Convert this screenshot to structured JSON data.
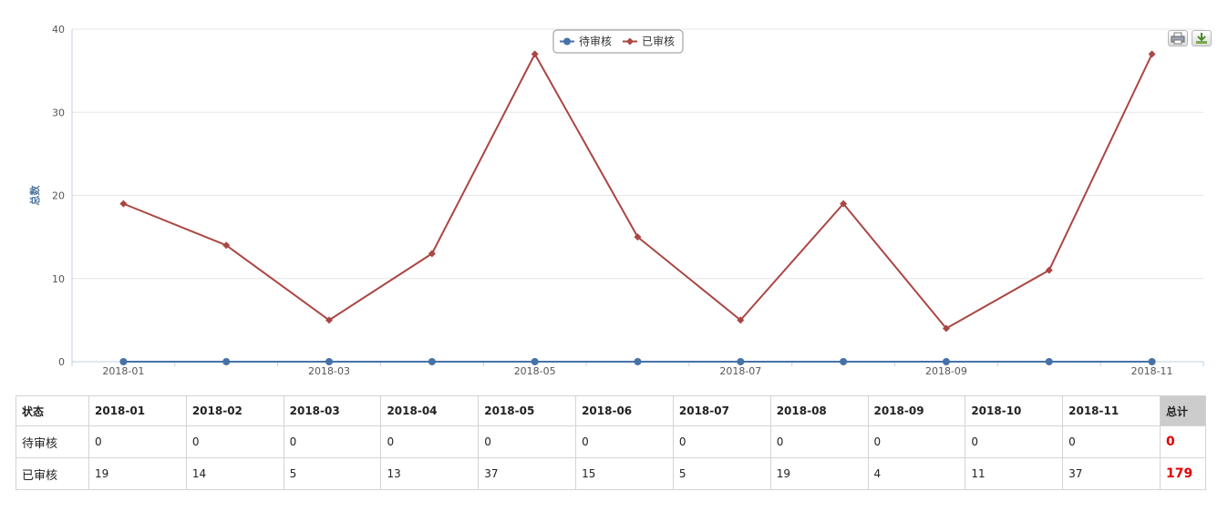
{
  "chart_data": {
    "type": "line",
    "categories": [
      "2018-01",
      "2018-02",
      "2018-03",
      "2018-04",
      "2018-05",
      "2018-06",
      "2018-07",
      "2018-08",
      "2018-09",
      "2018-10",
      "2018-11"
    ],
    "x_tick_labels": [
      "2018-01",
      "2018-03",
      "2018-05",
      "2018-07",
      "2018-09",
      "2018-11"
    ],
    "y_ticks": [
      0,
      10,
      20,
      30,
      40
    ],
    "ylim": [
      0,
      40
    ],
    "ylabel": "总数",
    "title": "",
    "grid": true,
    "legend_position": "top-center",
    "series": [
      {
        "name": "待审核",
        "color": "#4572A7",
        "marker": "circle",
        "values": [
          0,
          0,
          0,
          0,
          0,
          0,
          0,
          0,
          0,
          0,
          0
        ]
      },
      {
        "name": "已审核",
        "color": "#AA4643",
        "marker": "diamond",
        "values": [
          19,
          14,
          5,
          13,
          37,
          15,
          5,
          19,
          4,
          11,
          37
        ]
      }
    ]
  },
  "table": {
    "header_label": "状态",
    "total_label": "总计",
    "columns": [
      "2018-01",
      "2018-02",
      "2018-03",
      "2018-04",
      "2018-05",
      "2018-06",
      "2018-07",
      "2018-08",
      "2018-09",
      "2018-10",
      "2018-11"
    ],
    "rows": [
      {
        "label": "待审核",
        "values": [
          "0",
          "0",
          "0",
          "0",
          "0",
          "0",
          "0",
          "0",
          "0",
          "0",
          "0"
        ],
        "total": "0"
      },
      {
        "label": "已审核",
        "values": [
          "19",
          "14",
          "5",
          "13",
          "37",
          "15",
          "5",
          "19",
          "4",
          "11",
          "37"
        ],
        "total": "179"
      }
    ]
  },
  "toolbar": {
    "print_icon": "print-icon",
    "export_icon": "download-icon"
  }
}
